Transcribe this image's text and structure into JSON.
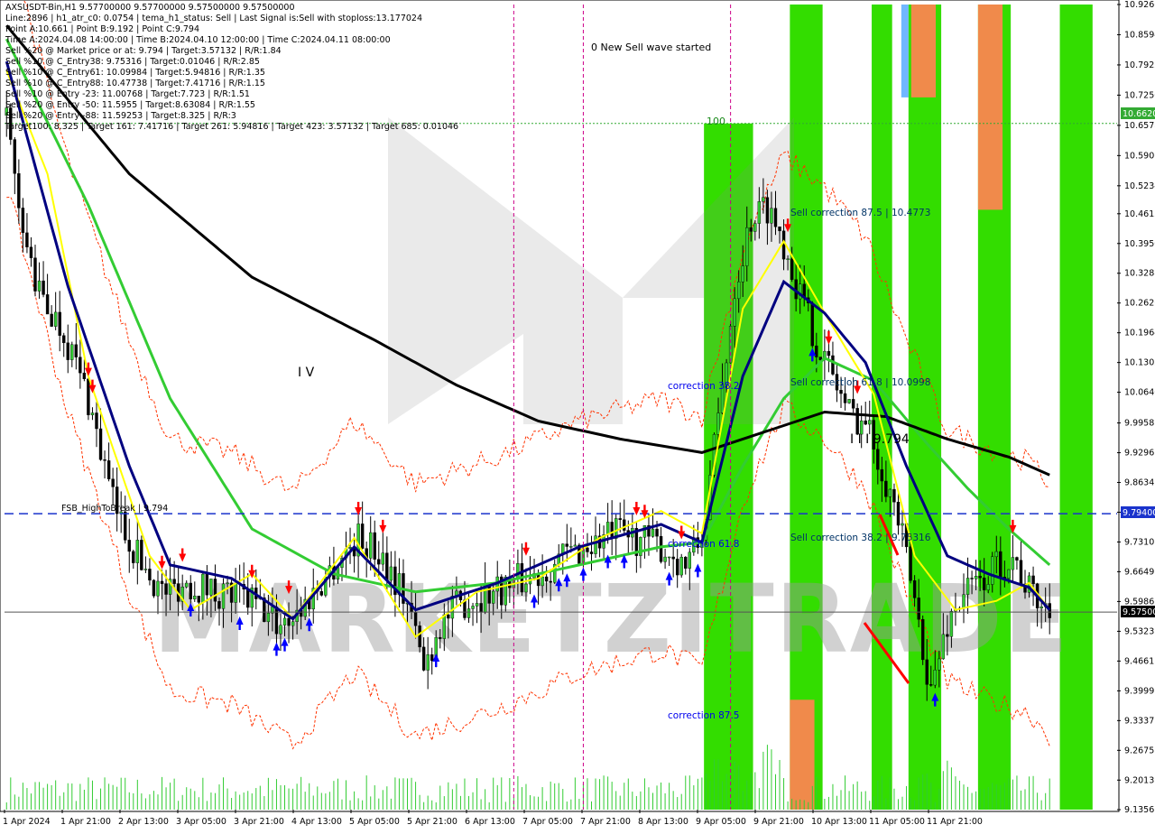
{
  "header_lines": [
    "AXSUSDT-Bin,H1  9.57700000 9.57700000 9.57500000 9.57500000",
    "Line:2896 | h1_atr_c0: 0.0754 | tema_h1_status: Sell | Last Signal is:Sell with stoploss:13.177024",
    "Point A:10.661 | Point B:9.192 | Point C:9.794",
    "Time A:2024.04.08 14:00:00 | Time B:2024.04.10 12:00:00 | Time C:2024.04.11 08:00:00",
    "Sell %20 @ Market price or at: 9.794 | Target:3.57132 | R/R:1.84",
    "Sell %10 @ C_Entry38: 9.75316 | Target:0.01046 | R/R:2.85",
    "Sell %10 @ C_Entry61: 10.09984 | Target:5.94816 | R/R:1.35",
    "Sell %10 @ C_Entry88: 10.47738 | Target:7.41716 | R/R:1.15",
    "Sell %10 @ Entry -23: 11.00768 | Target:7.723 | R/R:1.51",
    "Sell %20 @ Entry -50: 11.5955 | Target:8.63084 | R/R:1.55",
    "Sell %20 @ Entry -88: 11.59253 | Target:8.325 | R/R:3",
    "Target100: 8.325 | Target 161: 7.41716 | Target 261: 5.94816 | Target 423: 3.57132 | Target 685: 0.01046"
  ],
  "annotations": {
    "new_sell_wave": "0 New Sell wave started",
    "level_100": "100",
    "sell_corr_875": "Sell correction 87.5 | 10.4773",
    "sell_corr_618": "Sell correction 61.8 | 10.0998",
    "sell_corr_382": "Sell correction 38.2 | 9.75316",
    "correction_382": "correction 38.2",
    "correction_618": "correction 61.8",
    "correction_875": "correction 87.5",
    "wave_iv": "I V",
    "wave_label": "I I I 9.794",
    "fsb": "FSB_HighToBreak | 9.794",
    "watermark": "MARKETZITRADE"
  },
  "price_boxes": {
    "top": "10.6620",
    "mid": "9.79400",
    "current": "9.57500"
  },
  "colors": {
    "bull_bar": "#33cc33",
    "bear_bar": "#000000",
    "green_zone": "#33dd00",
    "orange_zone": "#f08a4b",
    "blue_zone": "#3399ff",
    "ma_black": "#000000",
    "ma_navy": "#000080",
    "ma_yellow": "#ffff00",
    "ma_green": "#33cc33",
    "envelope": "#ff3300",
    "arrow_sell": "#ff0000",
    "arrow_buy": "#0000ff"
  },
  "chart_data": {
    "type": "candlestick",
    "symbol": "AXSUSDT-Bin",
    "timeframe": "H1",
    "ylim": [
      9.1356,
      10.9266
    ],
    "y_ticks": [
      "10.9266",
      "10.8594",
      "10.7922",
      "10.7250",
      "10.6578",
      "10.5906",
      "10.5234",
      "10.4612",
      "10.3950",
      "10.3288",
      "10.2626",
      "10.1964",
      "10.1302",
      "10.0640",
      "9.9958",
      "9.9296",
      "9.8634",
      "9.7972",
      "9.7310",
      "9.6649",
      "9.5986",
      "9.5323",
      "9.4661",
      "9.3999",
      "9.3337",
      "9.2675",
      "9.2013",
      "9.1356"
    ],
    "x_ticks": [
      "1 Apr 2024",
      "1 Apr 21:00",
      "2 Apr 13:00",
      "3 Apr 05:00",
      "3 Apr 21:00",
      "4 Apr 13:00",
      "5 Apr 05:00",
      "5 Apr 21:00",
      "6 Apr 13:00",
      "7 Apr 05:00",
      "7 Apr 21:00",
      "8 Apr 13:00",
      "9 Apr 05:00",
      "9 Apr 21:00",
      "10 Apr 13:00",
      "11 Apr 05:00",
      "11 Apr 21:00"
    ],
    "horizontal_levels": [
      10.662,
      9.794,
      9.575
    ],
    "close_path": [
      [
        0,
        10.68
      ],
      [
        3,
        10.45
      ],
      [
        8,
        10.28
      ],
      [
        14,
        10.2
      ],
      [
        20,
        10.05
      ],
      [
        26,
        9.82
      ],
      [
        32,
        9.7
      ],
      [
        38,
        9.62
      ],
      [
        44,
        9.64
      ],
      [
        52,
        9.62
      ],
      [
        60,
        9.6
      ],
      [
        66,
        9.55
      ],
      [
        72,
        9.58
      ],
      [
        80,
        9.68
      ],
      [
        86,
        9.74
      ],
      [
        92,
        9.7
      ],
      [
        98,
        9.6
      ],
      [
        102,
        9.45
      ],
      [
        106,
        9.55
      ],
      [
        112,
        9.6
      ],
      [
        118,
        9.62
      ],
      [
        124,
        9.64
      ],
      [
        130,
        9.66
      ],
      [
        136,
        9.7
      ],
      [
        142,
        9.72
      ],
      [
        148,
        9.75
      ],
      [
        154,
        9.74
      ],
      [
        160,
        9.72
      ],
      [
        166,
        9.68
      ],
      [
        170,
        9.74
      ],
      [
        174,
        10.0
      ],
      [
        178,
        10.3
      ],
      [
        182,
        10.45
      ],
      [
        186,
        10.48
      ],
      [
        190,
        10.4
      ],
      [
        194,
        10.28
      ],
      [
        198,
        10.18
      ],
      [
        202,
        10.1
      ],
      [
        206,
        10.02
      ],
      [
        210,
        10.0
      ],
      [
        214,
        9.9
      ],
      [
        218,
        9.78
      ],
      [
        222,
        9.6
      ],
      [
        226,
        9.4
      ],
      [
        230,
        9.55
      ],
      [
        234,
        9.62
      ],
      [
        238,
        9.64
      ],
      [
        242,
        9.68
      ],
      [
        246,
        9.7
      ],
      [
        250,
        9.62
      ],
      [
        255,
        9.575
      ]
    ],
    "bar_count": 256,
    "ma_black": [
      [
        0,
        10.88
      ],
      [
        30,
        10.55
      ],
      [
        60,
        10.32
      ],
      [
        90,
        10.18
      ],
      [
        110,
        10.08
      ],
      [
        130,
        10.0
      ],
      [
        150,
        9.96
      ],
      [
        170,
        9.93
      ],
      [
        180,
        9.96
      ],
      [
        200,
        10.02
      ],
      [
        215,
        10.01
      ],
      [
        230,
        9.96
      ],
      [
        245,
        9.92
      ],
      [
        255,
        9.88
      ]
    ],
    "ma_navy": [
      [
        0,
        10.8
      ],
      [
        15,
        10.3
      ],
      [
        30,
        9.9
      ],
      [
        40,
        9.68
      ],
      [
        55,
        9.65
      ],
      [
        70,
        9.56
      ],
      [
        85,
        9.72
      ],
      [
        100,
        9.58
      ],
      [
        120,
        9.64
      ],
      [
        140,
        9.72
      ],
      [
        160,
        9.77
      ],
      [
        170,
        9.73
      ],
      [
        180,
        10.1
      ],
      [
        190,
        10.31
      ],
      [
        200,
        10.24
      ],
      [
        210,
        10.13
      ],
      [
        220,
        9.9
      ],
      [
        230,
        9.7
      ],
      [
        240,
        9.66
      ],
      [
        250,
        9.63
      ],
      [
        255,
        9.58
      ]
    ],
    "ma_yellow": [
      [
        0,
        10.78
      ],
      [
        10,
        10.55
      ],
      [
        20,
        10.1
      ],
      [
        35,
        9.7
      ],
      [
        45,
        9.58
      ],
      [
        60,
        9.66
      ],
      [
        70,
        9.56
      ],
      [
        85,
        9.74
      ],
      [
        100,
        9.52
      ],
      [
        115,
        9.62
      ],
      [
        130,
        9.65
      ],
      [
        145,
        9.74
      ],
      [
        160,
        9.8
      ],
      [
        170,
        9.75
      ],
      [
        180,
        10.25
      ],
      [
        190,
        10.4
      ],
      [
        200,
        10.24
      ],
      [
        212,
        10.06
      ],
      [
        222,
        9.7
      ],
      [
        232,
        9.58
      ],
      [
        242,
        9.6
      ],
      [
        250,
        9.64
      ],
      [
        255,
        9.58
      ]
    ],
    "ma_green": [
      [
        0,
        10.85
      ],
      [
        20,
        10.48
      ],
      [
        40,
        10.05
      ],
      [
        60,
        9.76
      ],
      [
        80,
        9.66
      ],
      [
        100,
        9.62
      ],
      [
        120,
        9.64
      ],
      [
        140,
        9.68
      ],
      [
        160,
        9.72
      ],
      [
        170,
        9.73
      ],
      [
        180,
        9.9
      ],
      [
        190,
        10.05
      ],
      [
        200,
        10.14
      ],
      [
        212,
        10.09
      ],
      [
        225,
        9.95
      ],
      [
        235,
        9.85
      ],
      [
        245,
        9.76
      ],
      [
        255,
        9.68
      ]
    ],
    "vertical_lines_dashed": [
      124,
      141,
      177
    ],
    "green_zones": [
      [
        171,
        183
      ],
      [
        192,
        200
      ],
      [
        212,
        217
      ],
      [
        221,
        229
      ],
      [
        238,
        246
      ],
      [
        258,
        266
      ]
    ],
    "orange_zones": [
      [
        192,
        200
      ],
      [
        221,
        229
      ],
      [
        238,
        246
      ]
    ],
    "sell_arrows": [
      20,
      21,
      38,
      43,
      60,
      69,
      86,
      92,
      127,
      154,
      156,
      165,
      191,
      201,
      208,
      246
    ],
    "buy_arrows": [
      45,
      57,
      66,
      68,
      74,
      105,
      129,
      135,
      137,
      141,
      147,
      151,
      162,
      169,
      197,
      227
    ]
  }
}
